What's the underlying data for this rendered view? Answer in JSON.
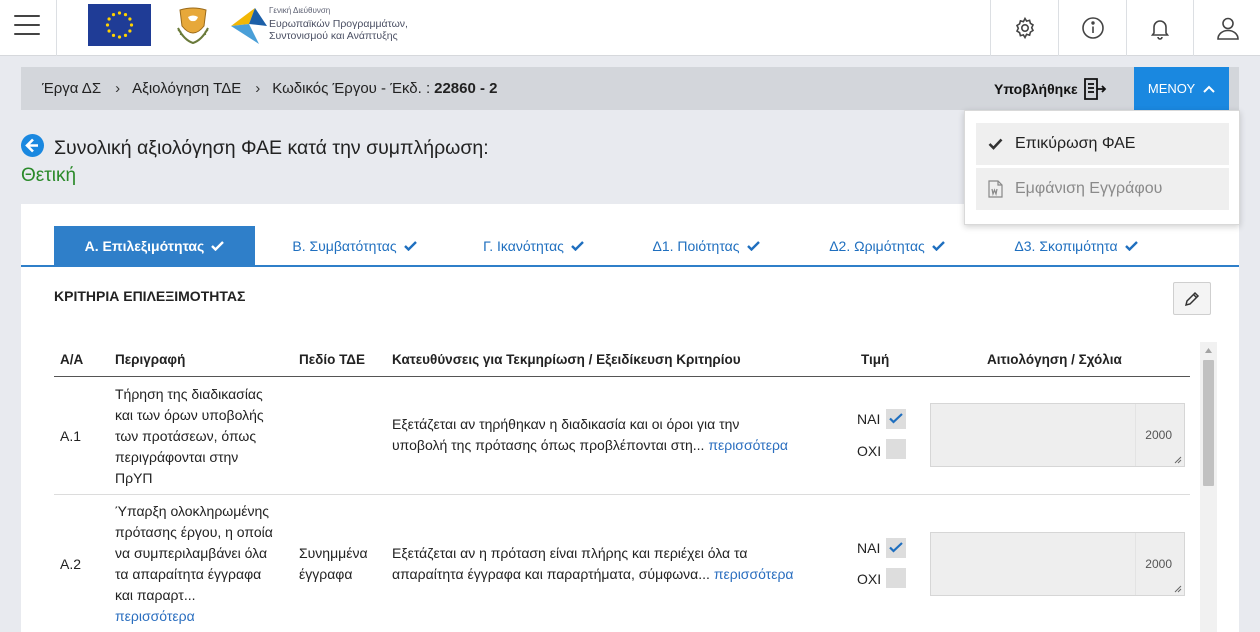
{
  "header": {
    "agency_small": "Γενική Διεύθυνση",
    "agency_line1": "Ευρωπαϊκών Προγραμμάτων,",
    "agency_line2": "Συντονισμού και Ανάπτυξης",
    "icons": [
      "settings-icon",
      "info-icon",
      "bell-icon",
      "user-icon"
    ]
  },
  "breadcrumb": {
    "item1": "Έργα ΔΣ",
    "item2": "Αξιολόγηση ΤΔΕ",
    "item3": "Κωδικός Έργου - Έκδ. :",
    "item3_code": "22860 - 2"
  },
  "status_submitted": "Υποβλήθηκε",
  "menu_label": "ΜΕΝΟΥ",
  "dropdown": {
    "item1": "Επικύρωση ΦΑΕ",
    "item2": "Εμφάνιση Εγγράφου"
  },
  "page_title": "Συνολική αξιολόγηση ΦΑΕ κατά την συμπλήρωση:",
  "status_text": "Θετική",
  "tabs": [
    {
      "label": "Α. Επιλεξιμότητας"
    },
    {
      "label": "Β. Συμβατότητας"
    },
    {
      "label": "Γ. Ικανότητας"
    },
    {
      "label": "Δ1. Ποιότητας"
    },
    {
      "label": "Δ2. Ωριμότητας"
    },
    {
      "label": "Δ3. Σκοπιμότητα"
    }
  ],
  "section_title": "ΚΡΙΤΗΡΙΑ ΕΠΙΛΕΞΙΜΟΤΗΤΑΣ",
  "table": {
    "headers": [
      "Α/Α",
      "Περιγραφή",
      "Πεδίο ΤΔΕ",
      "Κατευθύνσεις για Τεκμηρίωση / Εξειδίκευση Κριτηρίου",
      "Τιμή",
      "Αιτιολόγηση / Σχόλια"
    ],
    "rows": [
      {
        "id": "Α.1",
        "desc_lines": [
          "Τήρηση της διαδικασίας",
          "και των όρων υποβολής",
          "των προτάσεων, όπως",
          "περιγράφονται στην",
          "ΠρΥΠ"
        ],
        "field": "",
        "guide_line1": "Εξετάζεται αν τηρήθηκαν η διαδικασία και οι όροι για την",
        "guide_line2": "υποβολή της πρότασης όπως προβλέπονται στη...",
        "more": "περισσότερα",
        "yes_label": "ΝΑΙ",
        "no_label": "ΟΧΙ",
        "yes_checked": true,
        "no_checked": false,
        "char_limit": "2000"
      },
      {
        "id": "Α.2",
        "desc_lines": [
          "Ύπαρξη ολοκληρωμένης",
          "πρότασης έργου, η οποία",
          "να συμπεριλαμβάνει όλα",
          "τα απαραίτητα έγγραφα",
          "και παραρτ..."
        ],
        "desc_more": "περισσότερα",
        "field_line1": "Συνημμένα",
        "field_line2": "έγγραφα",
        "guide_line1": "Εξετάζεται αν η πρόταση είναι πλήρης και περιέχει όλα τα",
        "guide_line2": "απαραίτητα έγγραφα και παραρτήματα, σύμφωνα...",
        "more": "περισσότερα",
        "yes_label": "ΝΑΙ",
        "no_label": "ΟΧΙ",
        "yes_checked": true,
        "no_checked": false,
        "char_limit": "2000"
      }
    ]
  },
  "colors": {
    "primary": "#2f7fc9",
    "menu_button": "#1a88e0",
    "positive": "#2a8a2a",
    "link": "#2a6ebf"
  }
}
